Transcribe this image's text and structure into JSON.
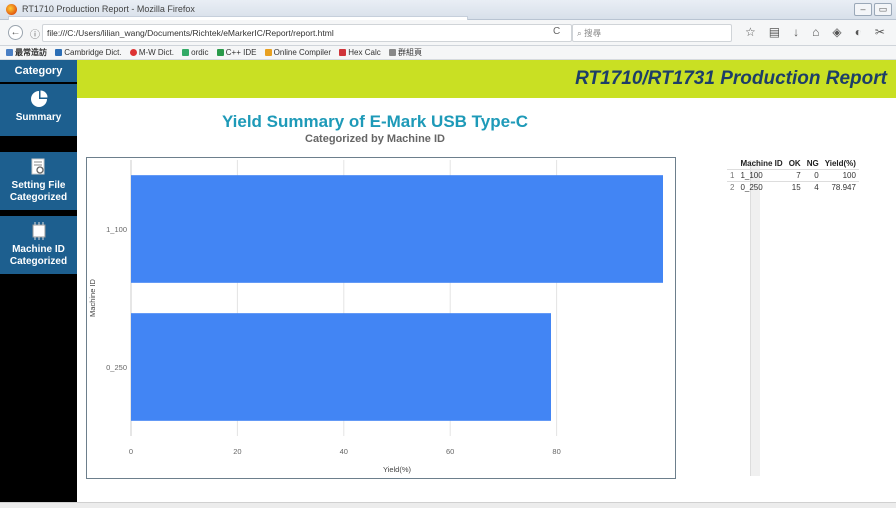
{
  "browser": {
    "window_title": "RT1710 Production Report - Mozilla Firefox",
    "url": "file:///C:/Users/lilian_wang/Documents/Richtek/eMarkerIC/Report/report.html",
    "search_placeholder": "搜尋",
    "bookmarks": [
      "最常造訪",
      "Cambridge Dict.",
      "M-W Dict.",
      "ordic",
      "C++ IDE",
      "Online Compiler",
      "Hex Calc",
      "群組頁"
    ]
  },
  "sidebar": {
    "category_label": "Category",
    "items": [
      {
        "label_line1": "Summary",
        "label_line2": ""
      },
      {
        "label_line1": "Setting File",
        "label_line2": "Categorized"
      },
      {
        "label_line1": "Machine ID",
        "label_line2": "Categorized"
      }
    ]
  },
  "header": {
    "title": "RT1710/RT1731 Production Report"
  },
  "chart_data": {
    "type": "bar",
    "orientation": "horizontal",
    "title": "Yield Summary of E-Mark USB Type-C",
    "subtitle": "Categorized by Machine ID",
    "xlabel": "Yield(%)",
    "ylabel": "Machine ID",
    "categories": [
      "1_100",
      "0_250"
    ],
    "values": [
      100,
      78.947
    ],
    "xlim": [
      0,
      100
    ],
    "xticks": [
      0,
      20,
      40,
      60,
      80
    ],
    "bar_color": "#4285f4",
    "grid": true
  },
  "table": {
    "headers": [
      "",
      "Machine ID",
      "OK",
      "NG",
      "Yield(%)"
    ],
    "rows": [
      [
        "1",
        "1_100",
        "7",
        "0",
        "100"
      ],
      [
        "2",
        "0_250",
        "15",
        "4",
        "78.947"
      ]
    ]
  },
  "colors": {
    "sidebar_active": "#1d5f8f",
    "header_bg": "#c9e023",
    "header_text": "#1d3e68",
    "chart_title": "#1e9ab8"
  }
}
